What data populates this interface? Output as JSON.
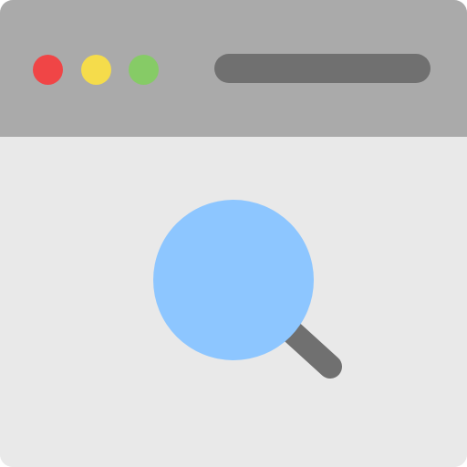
{
  "window": {
    "titlebar_color": "#aaaaaa",
    "content_color": "#e9e9e9",
    "controls": [
      {
        "name": "close",
        "color": "#f04546"
      },
      {
        "name": "minimize",
        "color": "#f5dc4b"
      },
      {
        "name": "maximize",
        "color": "#86cb66"
      }
    ],
    "address_bar": {
      "value": "",
      "color": "#707070"
    }
  },
  "main": {
    "icon": "magnifying-glass-icon",
    "lens_color": "#8dc6ff",
    "handle_color": "#707070"
  }
}
